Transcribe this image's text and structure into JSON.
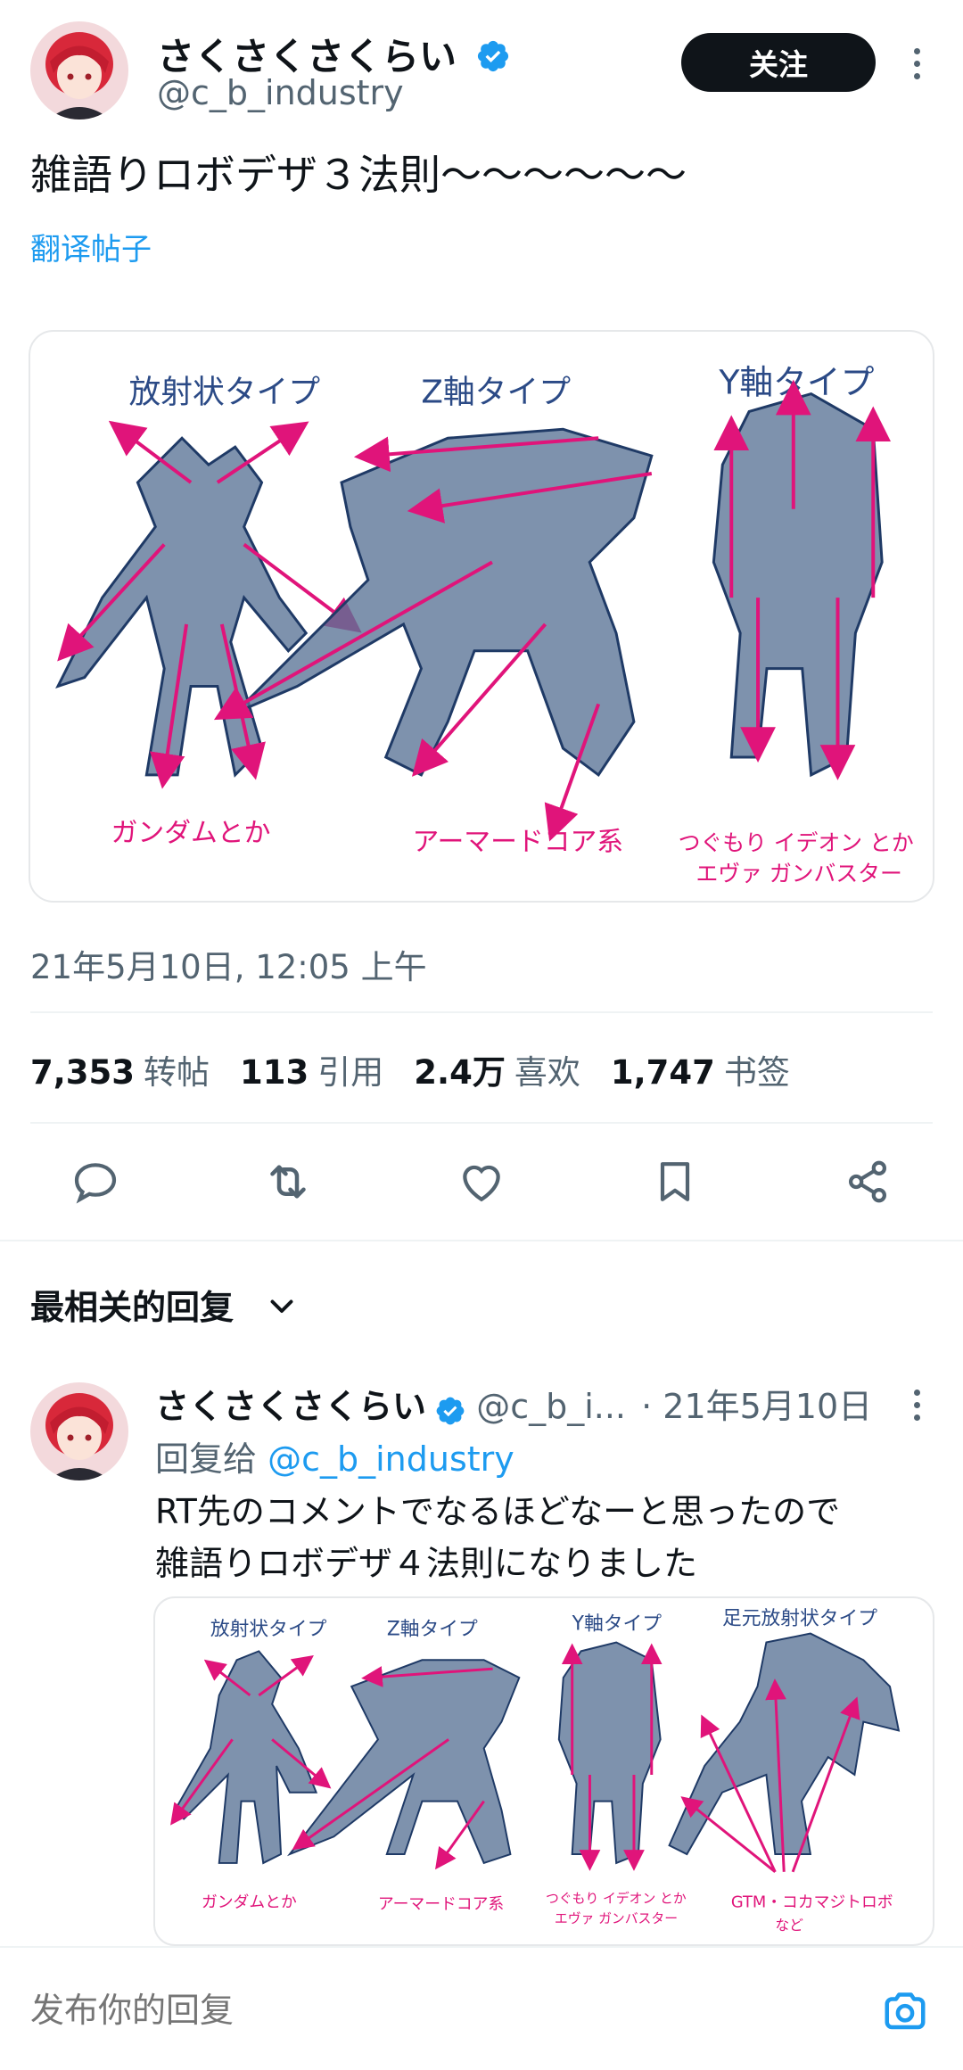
{
  "main_tweet": {
    "author_name": "さくさくさくらい",
    "author_handle": "@c_b_industry",
    "follow_label": "关注",
    "text": "雑語りロボデザ３法則～～～～～～",
    "translate_label": "翻译帖子",
    "image_labels": {
      "type_radial": "放射状タイプ",
      "type_z": "Z軸タイプ",
      "type_y": "Y軸タイプ",
      "note_radial": "ガンダムとか",
      "note_z": "アーマードコア系",
      "note_y_line1": "つぐもり イデオン とか",
      "note_y_line2": "エヴァ ガンバスター"
    },
    "timestamp": "21年5月10日, 12:05 上午",
    "stats": [
      {
        "value": "7,353",
        "label": "转帖"
      },
      {
        "value": "113",
        "label": "引用"
      },
      {
        "value": "2.4万",
        "label": "喜欢"
      },
      {
        "value": "1,747",
        "label": "书签"
      }
    ]
  },
  "actions": {
    "reply": "reply-icon",
    "retweet": "retweet-icon",
    "like": "heart-icon",
    "bookmark": "bookmark-icon",
    "share": "share-icon"
  },
  "replies_section": {
    "title": "最相关的回复"
  },
  "reply": {
    "author_name": "さくさくさくらい",
    "author_handle": "@c_b_i...",
    "date": "· 21年5月10日",
    "reply_to_prefix": "回复给",
    "reply_to_handle": "@c_b_industry",
    "text_line1": "RT先のコメントでなるほどなーと思ったので",
    "text_line2": "雑語りロボデザ４法則になりました",
    "image_labels": {
      "type_radial": "放射状タイプ",
      "type_z": "Z軸タイプ",
      "type_y": "Y軸タイプ",
      "type_foot": "足元放射状タイプ",
      "note_radial": "ガンダムとか",
      "note_z": "アーマードコア系",
      "note_y_line1": "つぐもり イデオン とか",
      "note_y_line2": "エヴァ ガンバスター",
      "note_foot_line1": "GTM・コカマジトロボ",
      "note_foot_line2": "など"
    }
  },
  "composer": {
    "placeholder": "发布你的回复"
  },
  "colors": {
    "follow_bg": "#0f1419",
    "link": "#1d9bf0",
    "verified": "#1d9bf0",
    "secondary_text": "#536471",
    "sketch_blue": "#5a7396",
    "sketch_pink": "#e0147a"
  }
}
